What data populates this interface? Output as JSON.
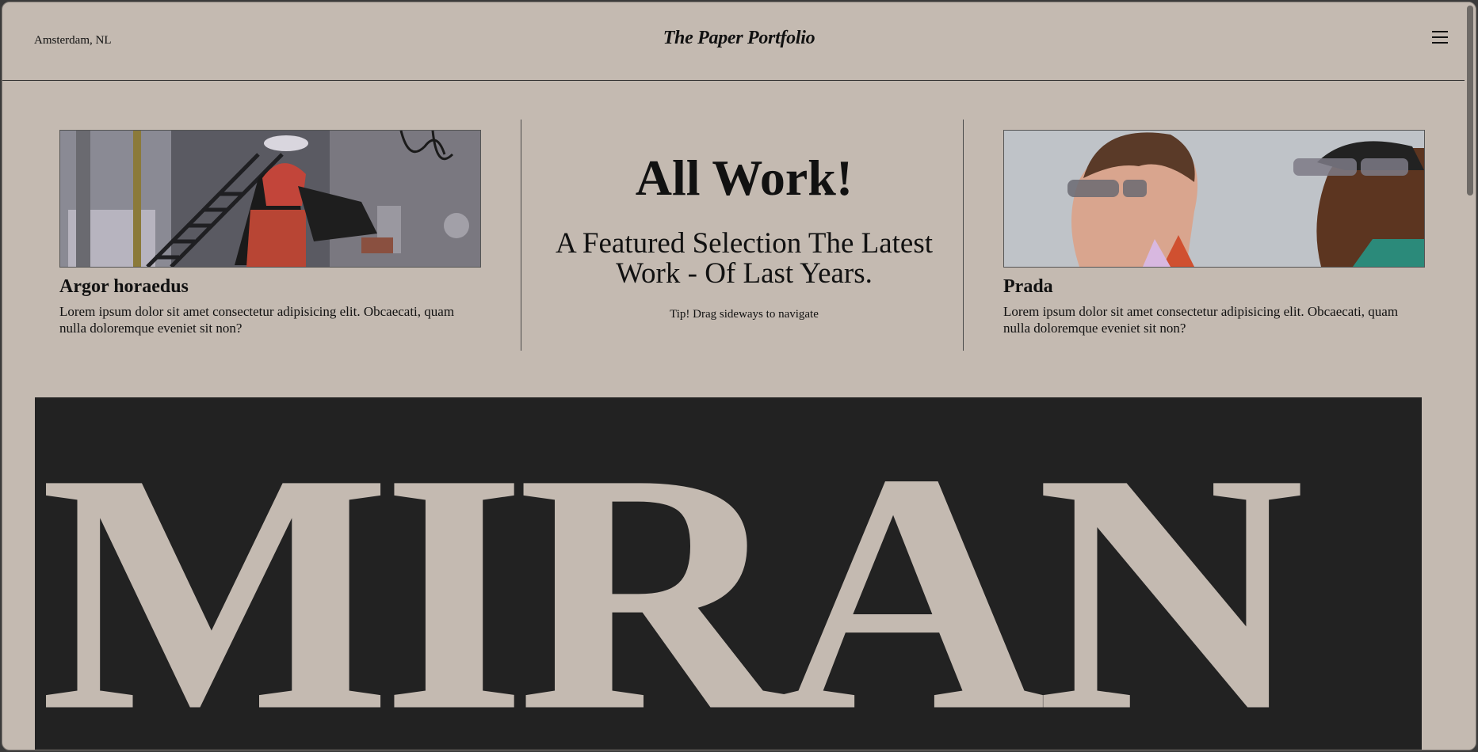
{
  "header": {
    "location": "Amsterdam, NL",
    "brand": "The Paper Portfolio",
    "menu_icon": "hamburger-menu-icon"
  },
  "featured": {
    "left_card": {
      "title": "Argor horaedus",
      "description": "Lorem ipsum dolor sit amet consectetur adipisicing elit. Obcaecati, quam nulla doloremque eveniet sit non?"
    },
    "center": {
      "headline": "All Work!",
      "subheadline": "A Featured Selection The Latest Work - Of Last Years.",
      "tip": "Tip! Drag sideways to navigate"
    },
    "right_card": {
      "title": "Prada",
      "description": "Lorem ipsum dolor sit amet consectetur adipisicing elit. Obcaecati, quam nulla doloremque eveniet sit non?"
    }
  },
  "banner": {
    "word": "MIRAN"
  },
  "colors": {
    "page_bg": "#c4bab1",
    "ink": "#111111",
    "banner_bg": "#222222",
    "banner_text": "#c4bab1"
  }
}
